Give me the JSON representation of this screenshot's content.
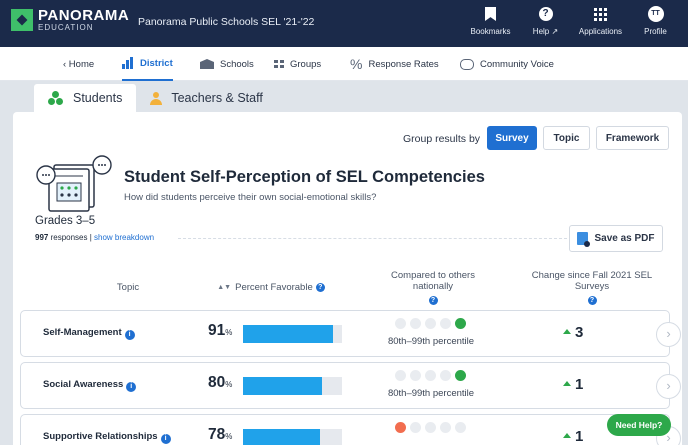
{
  "header": {
    "brand": "PANORAMA",
    "brand_sub": "EDUCATION",
    "district_title": "Panorama Public Schools SEL '21-'22",
    "nav": [
      {
        "label": "Bookmarks",
        "icon": "bookmark-icon"
      },
      {
        "label": "Help ↗",
        "icon": "help-icon",
        "glyph": "?"
      },
      {
        "label": "Applications",
        "icon": "apps-grid-icon"
      },
      {
        "label": "Profile",
        "icon": "avatar-icon",
        "initials": "TT"
      }
    ]
  },
  "subnav": {
    "home": "‹ Home",
    "district": "District",
    "schools": "Schools",
    "groups": "Groups",
    "response_rates": "Response Rates",
    "community_voice": "Community Voice"
  },
  "audience_tabs": {
    "students": "Students",
    "teachers": "Teachers & Staff"
  },
  "grouping": {
    "label": "Group results by",
    "options": [
      "Survey",
      "Topic",
      "Framework"
    ],
    "selected": "Survey"
  },
  "survey": {
    "title": "Student Self-Perception of SEL Competencies",
    "question": "How did students perceive their own social-emotional skills?"
  },
  "grade": "Grades 3–5",
  "responses": {
    "count": "997",
    "text": " responses | ",
    "breakdown_link": "show breakdown"
  },
  "save_pdf": "Save as PDF",
  "table": {
    "headers": {
      "topic": "Topic",
      "favorable": "Percent Favorable",
      "compared": "Compared to others nationally",
      "change": "Change since Fall 2021 SEL Surveys"
    },
    "rows": [
      {
        "topic": "Self-Management",
        "percent": 91,
        "pct_text": "91",
        "dots": [
          0,
          0,
          0,
          0,
          1
        ],
        "dot_color": "#2da84a",
        "percentile": "80th–99th percentile",
        "change": "3"
      },
      {
        "topic": "Social Awareness",
        "percent": 80,
        "pct_text": "80",
        "dots": [
          0,
          0,
          0,
          0,
          1
        ],
        "dot_color": "#2da84a",
        "percentile": "80th–99th percentile",
        "change": "1"
      },
      {
        "topic": "Supportive Relationships",
        "percent": 78,
        "pct_text": "78",
        "dots": [
          1,
          0,
          0,
          0,
          0
        ],
        "dot_color": "#f26d4f",
        "percentile": "",
        "change": "1"
      }
    ]
  },
  "need_help": "Need Help?",
  "colors": {
    "brand_navy": "#1b2a4a",
    "accent_blue": "#1f6fd1",
    "bar_blue": "#20a2ea",
    "good_green": "#2da84a",
    "low_orange": "#f26d4f"
  }
}
